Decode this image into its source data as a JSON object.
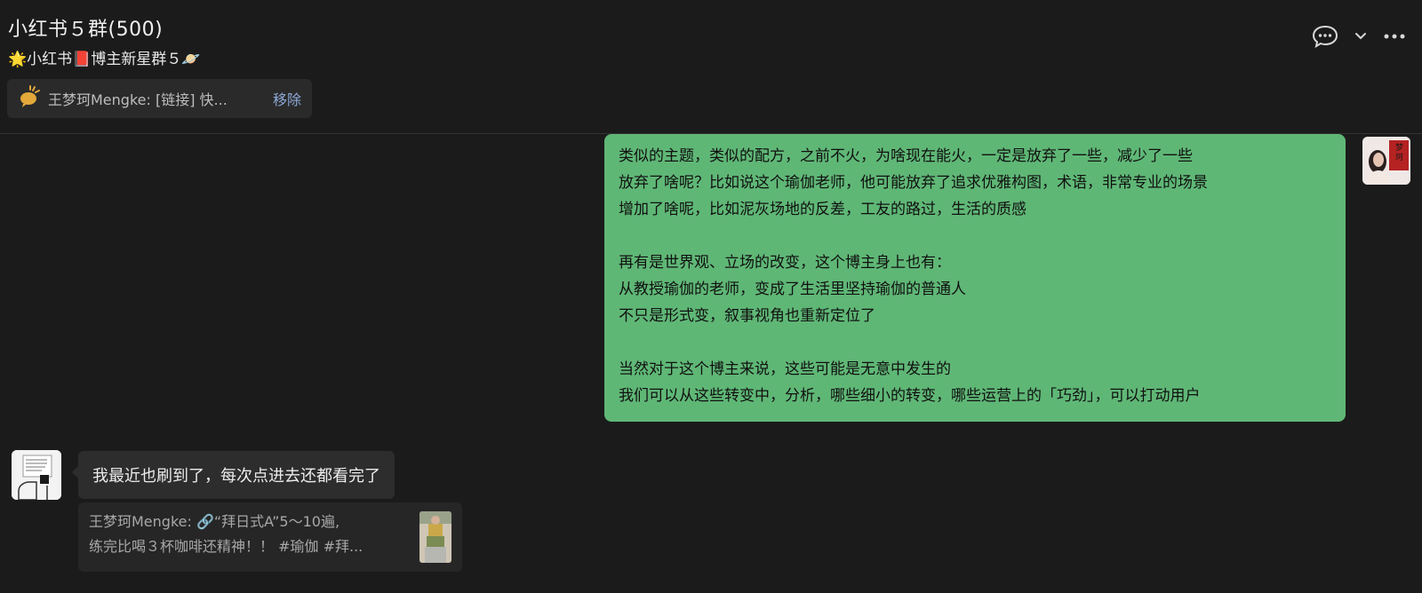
{
  "header": {
    "title": "小红书５群(500)",
    "subtitle": "🌟小红书📕博主新星群５🪐",
    "pinned": {
      "text": "王梦珂Mengke: [链接] 快...",
      "remove_label": "移除"
    },
    "icons": [
      "chat-bubble-icon",
      "chevron-down-icon",
      "more-icon"
    ]
  },
  "messages": {
    "own": {
      "text": "类似的主题，类似的配方，之前不火，为啥现在能火，一定是放弃了一些，减少了一些\n放弃了啥呢？比如说这个瑜伽老师，他可能放弃了追求优雅构图，术语，非常专业的场景\n增加了啥呢，比如泥灰场地的反差，工友的路过，生活的质感\n\n再有是世界观、立场的改变，这个博主身上也有：\n从教授瑜伽的老师，变成了生活里坚持瑜伽的普通人\n不只是形式变，叙事视角也重新定位了\n\n当然对于这个博主来说，这些可能是无意中发生的\n我们可以从这些转变中，分析，哪些细小的转变，哪些运营上的「巧劲」，可以打动用户",
      "avatar_text": "梦珂"
    },
    "other": {
      "text": "我最近也刷到了，每次点进去还都看完了",
      "quote_line1": "王梦珂Mengke: 🔗“拜日式A”5～10遍,",
      "quote_line2": "练完比喝３杯咖啡还精神！！ #瑜伽 #拜..."
    }
  },
  "colors": {
    "background": "#1b1b1b",
    "own_bubble": "#5fb776",
    "other_bubble": "#2d2d2d",
    "link": "#8da8d6"
  }
}
